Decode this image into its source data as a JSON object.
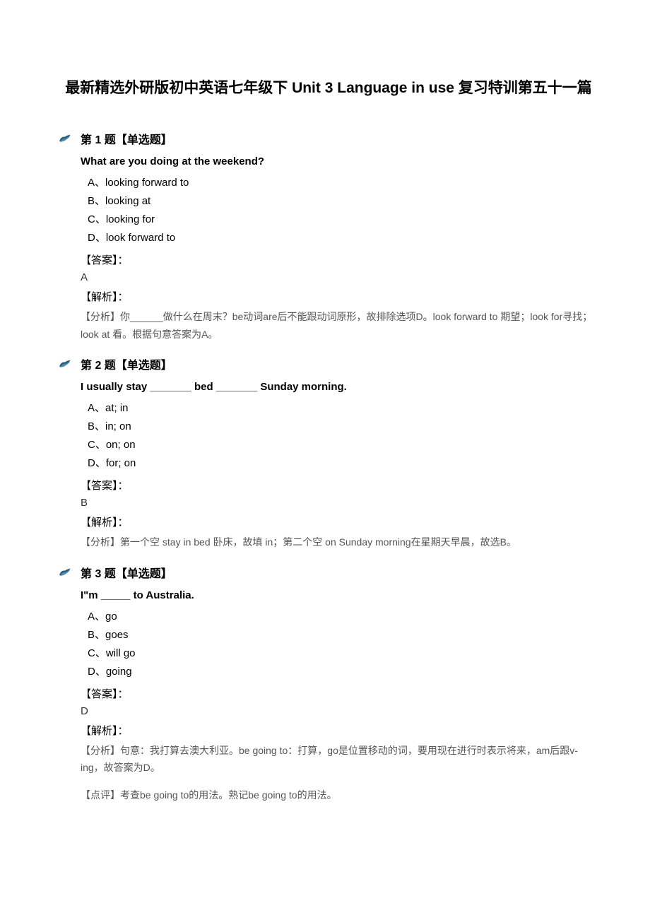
{
  "title": "最新精选外研版初中英语七年级下 Unit 3 Language in use 复习特训第五十一篇",
  "questions": [
    {
      "heading": "第 1 题【单选题】",
      "stem": "What are you doing at the weekend?",
      "options": [
        "A、looking forward to",
        "B、looking at",
        "C、looking for",
        "D、look forward to"
      ],
      "answer_label": "【答案】：",
      "answer": "A",
      "explain_label": "【解析】：",
      "explain": "【分析】你______做什么在周末？be动词are后不能跟动词原形，故排除选项D。look forward to 期望；look for寻找；look at 看。根据句意答案为A。"
    },
    {
      "heading": "第 2 题【单选题】",
      "stem": "I usually stay _______ bed _______ Sunday morning.",
      "options": [
        "A、at; in",
        "B、in; on",
        "C、on; on",
        "D、for; on"
      ],
      "answer_label": "【答案】：",
      "answer": "B",
      "explain_label": "【解析】：",
      "explain": "【分析】第一个空 stay in bed 卧床，故填 in；第二个空 on Sunday morning在星期天早晨，故选B。"
    },
    {
      "heading": "第 3 题【单选题】",
      "stem": "I\"m _____ to Australia.",
      "options": [
        "A、go",
        "B、goes",
        "C、will go",
        "D、going"
      ],
      "answer_label": "【答案】：",
      "answer": "D",
      "explain_label": "【解析】：",
      "explain": "【分析】句意：我打算去澳大利亚。be going to：打算，go是位置移动的词，要用现在进行时表示将来，am后跟v-ing，故答案为D。",
      "explain2": "【点评】考查be going to的用法。熟记be going to的用法。"
    }
  ]
}
